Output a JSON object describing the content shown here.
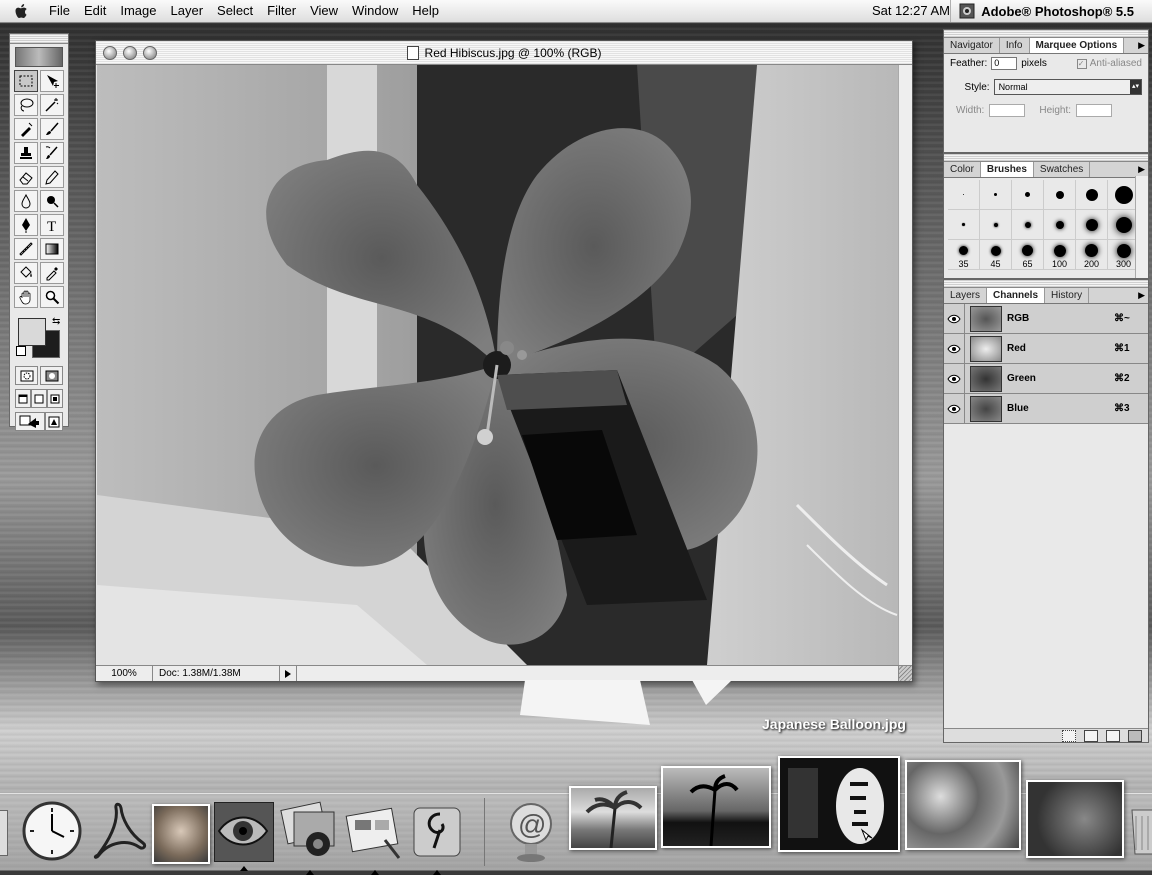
{
  "menubar": {
    "apple_icon": "apple-icon",
    "items": [
      "File",
      "Edit",
      "Image",
      "Layer",
      "Select",
      "Filter",
      "View",
      "Window",
      "Help"
    ],
    "clock": "Sat 12:27 AM",
    "app_name": "Adobe® Photoshop® 5.5"
  },
  "document": {
    "title": "Red Hibiscus.jpg @ 100% (RGB)",
    "zoom": "100%",
    "doc_size": "Doc: 1.38M/1.38M"
  },
  "marquee_palette": {
    "tabs": [
      "Navigator",
      "Info",
      "Marquee Options"
    ],
    "active_tab": "Marquee Options",
    "feather_label": "Feather:",
    "feather_value": "0",
    "feather_unit": "pixels",
    "anti_aliased_label": "Anti-aliased",
    "style_label": "Style:",
    "style_value": "Normal",
    "width_label": "Width:",
    "height_label": "Height:"
  },
  "brushes_palette": {
    "tabs": [
      "Color",
      "Brushes",
      "Swatches"
    ],
    "active_tab": "Brushes",
    "size_labels": [
      "35",
      "45",
      "65",
      "100",
      "200",
      "300"
    ]
  },
  "channels_palette": {
    "tabs": [
      "Layers",
      "Channels",
      "History"
    ],
    "active_tab": "Channels",
    "channels": [
      {
        "name": "RGB",
        "shortcut": "⌘~"
      },
      {
        "name": "Red",
        "shortcut": "⌘1"
      },
      {
        "name": "Green",
        "shortcut": "⌘2"
      },
      {
        "name": "Blue",
        "shortcut": "⌘3"
      }
    ]
  },
  "dock": {
    "hover_label": "Japanese Balloon.jpg",
    "icons": [
      "clock-icon",
      "acrobat-icon",
      "preview-icon",
      "eye-icon",
      "iphoto-icon",
      "presentation-icon",
      "sherlock-icon",
      "mail-icon"
    ]
  },
  "colors": {
    "menubar_bg": "#f0f0f0",
    "foreground_color": "#d9d9d9",
    "background_color": "#1d1d1d"
  }
}
